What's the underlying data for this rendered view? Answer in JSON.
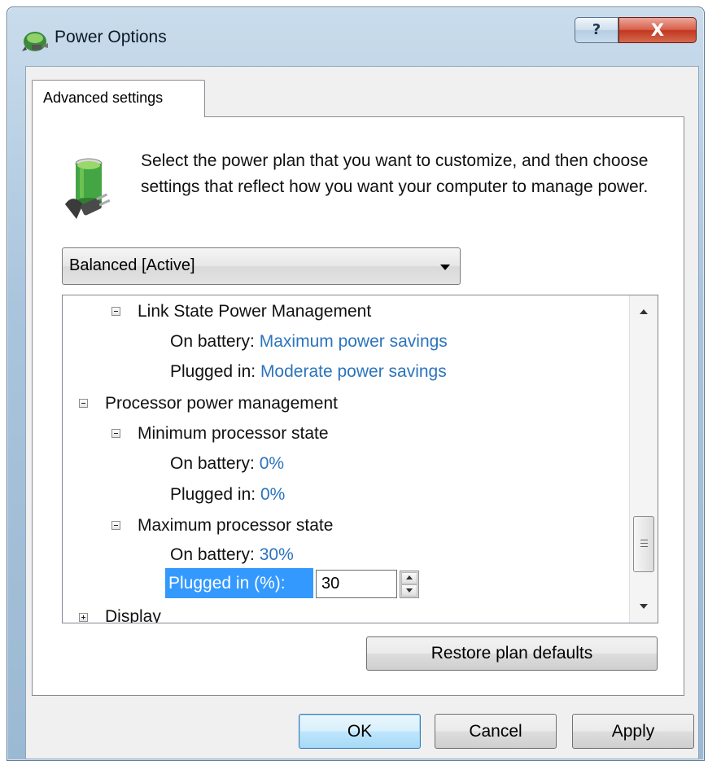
{
  "window": {
    "title": "Power Options",
    "help_label": "?",
    "close_label": "X"
  },
  "tab": {
    "label": "Advanced settings"
  },
  "intro_text": "Select the power plan that you want to customize, and then choose settings that reflect how you want your computer to manage power.",
  "plan_select": {
    "value": "Balanced [Active]"
  },
  "tree": {
    "link_state": {
      "label": "Link State Power Management",
      "on_battery_label": "On battery:",
      "on_battery_value": "Maximum power savings",
      "plugged_in_label": "Plugged in:",
      "plugged_in_value": "Moderate power savings"
    },
    "processor": {
      "label": "Processor power management",
      "min_state": {
        "label": "Minimum processor state",
        "on_battery_label": "On battery:",
        "on_battery_value": "0%",
        "plugged_in_label": "Plugged in:",
        "plugged_in_value": "0%"
      },
      "max_state": {
        "label": "Maximum processor state",
        "on_battery_label": "On battery:",
        "on_battery_value": "30%",
        "plugged_in_label": "Plugged in (%):",
        "plugged_in_value": "30"
      }
    },
    "display": {
      "label": "Display"
    }
  },
  "buttons": {
    "restore": "Restore plan defaults",
    "ok": "OK",
    "cancel": "Cancel",
    "apply": "Apply"
  },
  "colors": {
    "value_link": "#2b74bd",
    "selection": "#3399ff",
    "close_button": "#c2371f"
  },
  "icons": [
    "power-options-icon",
    "help-icon",
    "close-icon",
    "battery-plug-icon",
    "dropdown-arrow-icon",
    "collapse-icon",
    "expand-icon",
    "spin-up-icon",
    "spin-down-icon",
    "scroll-up-icon",
    "scroll-down-icon"
  ]
}
